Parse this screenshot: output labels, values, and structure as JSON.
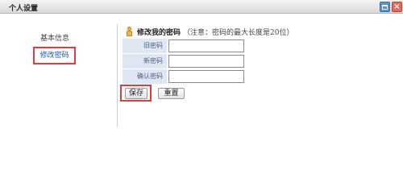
{
  "window": {
    "title": "个人设置",
    "maximize_icon": "maximize-icon",
    "close_icon": "close-icon",
    "close_glyph": "×"
  },
  "sidebar": {
    "items": [
      {
        "label": "基本信息",
        "selected": false
      },
      {
        "label": "修改密码",
        "selected": true
      }
    ]
  },
  "section": {
    "icon": "user-icon",
    "title": "修改我的密码",
    "note": "（注意：密码的最大长度是20位）"
  },
  "form": {
    "fields": [
      {
        "label": "旧密码",
        "value": ""
      },
      {
        "label": "新密码",
        "value": ""
      },
      {
        "label": "确认密码",
        "value": ""
      }
    ]
  },
  "buttons": {
    "save": "保存",
    "reset": "重置"
  },
  "colors": {
    "highlight": "#e23b3b",
    "label_bg": "#dfe7f3",
    "link": "#1a55b5"
  }
}
